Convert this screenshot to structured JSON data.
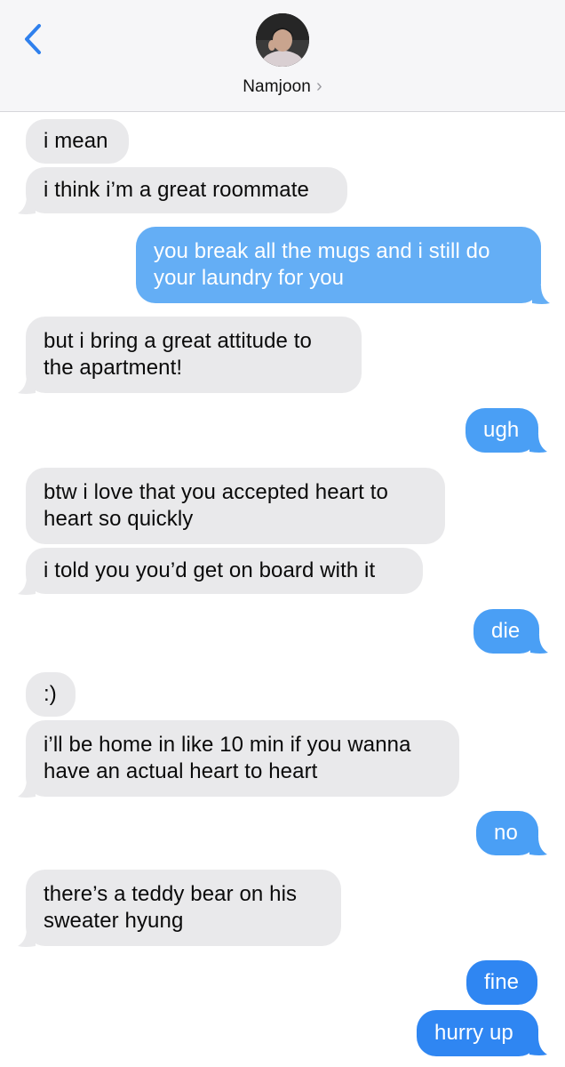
{
  "header": {
    "contact_name": "Namjoon",
    "contact_chevron": "›",
    "back_icon": "chevron-left-icon",
    "accent": "#2f80ed"
  },
  "colors": {
    "incoming_bubble": "#e9e9eb",
    "outgoing_bubble": "#4a9ff5",
    "outgoing_text": "#ffffff"
  },
  "messages": [
    {
      "from": "them",
      "text": "i mean"
    },
    {
      "from": "them",
      "text": "i think i’m a great roommate"
    },
    {
      "from": "me",
      "text": "you break all the mugs and i still do your laundry for you"
    },
    {
      "from": "them",
      "text": "but i bring a great attitude to the apartment!"
    },
    {
      "from": "me",
      "text": "ugh"
    },
    {
      "from": "them",
      "text": "btw i love that you accepted heart to heart so quickly"
    },
    {
      "from": "them",
      "text": "i told you you’d get on board with it"
    },
    {
      "from": "me",
      "text": "die"
    },
    {
      "from": "them",
      "text": ":)"
    },
    {
      "from": "them",
      "text": "i’ll be home in like 10 min if you wanna have an actual heart to heart"
    },
    {
      "from": "me",
      "text": "no"
    },
    {
      "from": "them",
      "text": "there’s a teddy bear on his sweater hyung"
    },
    {
      "from": "me",
      "text": "fine"
    },
    {
      "from": "me",
      "text": "hurry up"
    }
  ]
}
